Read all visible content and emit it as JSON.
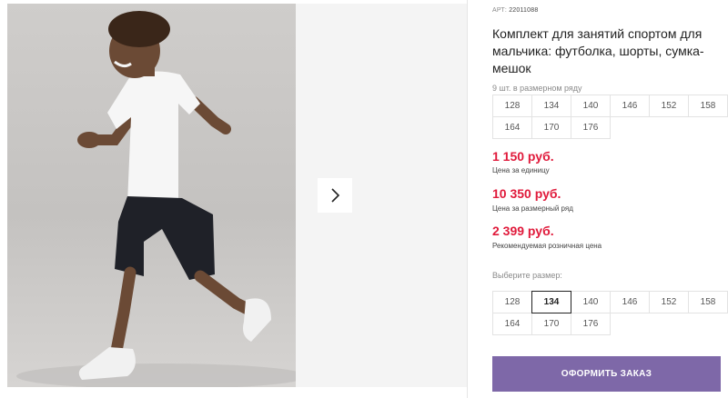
{
  "product": {
    "article_label": "АРТ:",
    "article_number": "22011088",
    "title": "Комплект для занятий спортом для мальчика: футболка, шорты, сумка-мешок"
  },
  "size_set": {
    "note": "9 шт. в размерном ряду",
    "sizes": [
      "128",
      "134",
      "140",
      "146",
      "152",
      "158",
      "164",
      "170",
      "176"
    ]
  },
  "prices": [
    {
      "value": "1 150 руб.",
      "caption": "Цена за единицу"
    },
    {
      "value": "10 350 руб.",
      "caption": "Цена за размерный ряд"
    },
    {
      "value": "2 399 руб.",
      "caption": "Рекомендуемая розничная цена"
    }
  ],
  "size_picker": {
    "label": "Выберите размер:",
    "sizes": [
      "128",
      "134",
      "140",
      "146",
      "152",
      "158",
      "164",
      "170",
      "176"
    ],
    "selected": "134"
  },
  "order_button": "ОФОРМИТЬ ЗАКАЗ",
  "gallery": {
    "next_icon": "chevron-right-icon"
  },
  "colors": {
    "price": "#e01a3b",
    "button": "#7e68a8",
    "selected_border": "#222222"
  }
}
